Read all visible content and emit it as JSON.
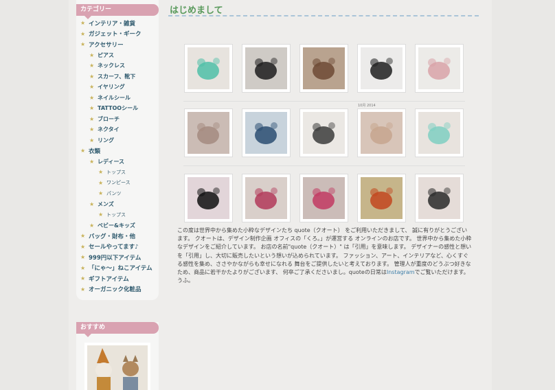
{
  "sidebar": {
    "categories_title": "カテゴリー",
    "categories": [
      {
        "label": "インテリア・雑貨",
        "level": 1
      },
      {
        "label": "ガジェット・ギーク",
        "level": 1
      },
      {
        "label": "アクセサリー",
        "level": 1
      },
      {
        "label": "ピアス",
        "level": 2
      },
      {
        "label": "ネックレス",
        "level": 2
      },
      {
        "label": "スカーフ、靴下",
        "level": 2
      },
      {
        "label": "イヤリング",
        "level": 2
      },
      {
        "label": "ネイルシール",
        "level": 2
      },
      {
        "label": "TATTOOシール",
        "level": 2
      },
      {
        "label": "ブローチ",
        "level": 2
      },
      {
        "label": "ネクタイ",
        "level": 2
      },
      {
        "label": "リング",
        "level": 2
      },
      {
        "label": "衣類",
        "level": 1
      },
      {
        "label": "レディース",
        "level": 2
      },
      {
        "label": "トップス",
        "level": 3
      },
      {
        "label": "ワンピース",
        "level": 3
      },
      {
        "label": "パンツ",
        "level": 3
      },
      {
        "label": "メンズ",
        "level": 2
      },
      {
        "label": "トップス",
        "level": 3
      },
      {
        "label": "ベビー&キッズ",
        "level": 2
      },
      {
        "label": "バッグ・財布・他",
        "level": 1
      },
      {
        "label": "セールやってます♪",
        "level": 1
      },
      {
        "label": "999円以下アイテム",
        "level": 1
      },
      {
        "label": "「にゃ〜」ねこアイテム",
        "level": 1
      },
      {
        "label": "ギフトアイテム",
        "level": 1
      },
      {
        "label": "オーガニック化粧品",
        "level": 1
      }
    ],
    "recommend_title": "おすすめ"
  },
  "main": {
    "title": "はじめまして",
    "date_label": "10月 2014",
    "thumbnails": [
      {
        "name": "thumb-colorful-yarn",
        "bg": "#e7e3de",
        "accent": "#4fbfa8"
      },
      {
        "name": "thumb-black-cat",
        "bg": "#cfcbc6",
        "accent": "#1d1d1d"
      },
      {
        "name": "thumb-cats-portrait",
        "bg": "#b9a38f",
        "accent": "#6d4a35"
      },
      {
        "name": "thumb-cat-earrings",
        "bg": "#ecebea",
        "accent": "#202020"
      },
      {
        "name": "thumb-bow-earrings",
        "bg": "#ecebe8",
        "accent": "#d9a3a8"
      },
      {
        "name": "thumb-woman-face",
        "bg": "#cbbcb5",
        "accent": "#a58b80"
      },
      {
        "name": "thumb-mirror-print",
        "bg": "#c8d3dc",
        "accent": "#2b4e72"
      },
      {
        "name": "thumb-diamond-earrings",
        "bg": "#ebe8e4",
        "accent": "#3c3c3c"
      },
      {
        "name": "thumb-ear-model",
        "bg": "#d8c5b9",
        "accent": "#c7a58e"
      },
      {
        "name": "thumb-pastel-bows",
        "bg": "#e8e3de",
        "accent": "#7fcfc2"
      },
      {
        "name": "thumb-cat-brooch",
        "bg": "#e2d5d9",
        "accent": "#111111"
      },
      {
        "name": "thumb-woman-black-cat",
        "bg": "#d9cfca",
        "accent": "#b23a5a"
      },
      {
        "name": "thumb-woman-hug-cat",
        "bg": "#cbbcb8",
        "accent": "#c23a62"
      },
      {
        "name": "thumb-cat-illustration",
        "bg": "#c6b58a",
        "accent": "#c2471e"
      },
      {
        "name": "thumb-cat-held",
        "bg": "#e5dcd8",
        "accent": "#2a2a2a"
      }
    ],
    "description_pre": "この度は世界中から集めた小粋なデザインたち quote（クオート） をご利用いただきまして、 誠に有りがとうございます。 クオートは、デザイン制作企画 オフィスの「くろ。」が運営する オンラインのお店です。 世界中から集めた小粋なデザインをご紹介しています。 お店の名前\"quote（クオート）\" は「引用」を意味します。 デザイナーの感性と想いを「引用」し、大切に販売したいという想いが込められています。 ファッション、アート、インテリアなど、心くすぐる感性を集め、ささやかながらも幸せになれる 舞台をご提供したいと考えております。 管理人が重度のどうぶつ好きなため、商品に若干かたよりがございます、 何卒ご了承くださいまし。quoteの日常は",
    "description_link": "Instagram",
    "description_post": "でご覧いただけます。うふ。"
  }
}
